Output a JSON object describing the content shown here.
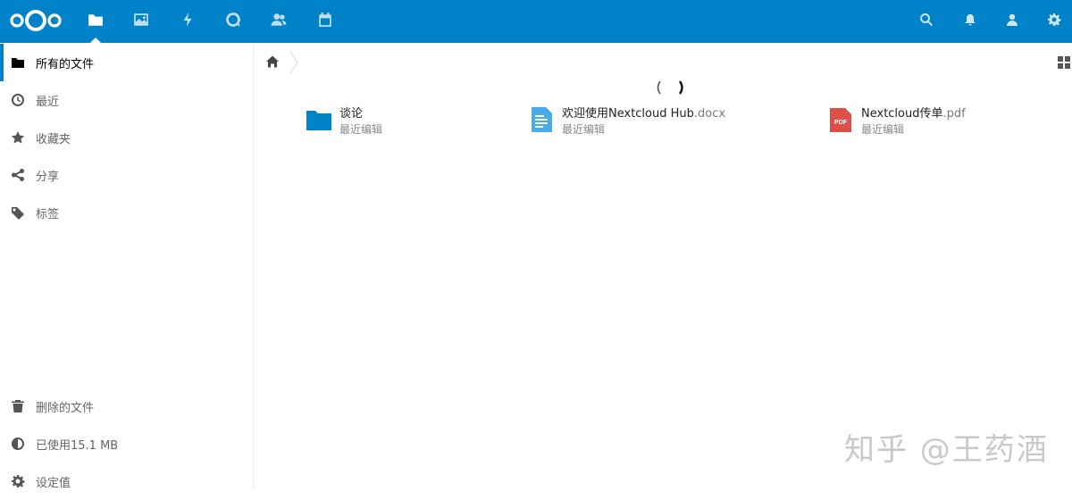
{
  "topbar": {
    "accent": "#0082c9",
    "apps": [
      {
        "name": "files",
        "icon": "folder-icon",
        "active": true
      },
      {
        "name": "photos",
        "icon": "image-icon"
      },
      {
        "name": "activity",
        "icon": "lightning-icon"
      },
      {
        "name": "talk",
        "icon": "talk-icon"
      },
      {
        "name": "contacts",
        "icon": "contacts-icon"
      },
      {
        "name": "calendar",
        "icon": "calendar-icon"
      }
    ],
    "right_icons": [
      "search-icon",
      "bell-icon",
      "user-icon",
      "gear-icon"
    ]
  },
  "sidebar": {
    "items": [
      {
        "label": "所有的文件",
        "icon": "folder-icon",
        "active": true
      },
      {
        "label": "最近",
        "icon": "clock-icon"
      },
      {
        "label": "收藏夹",
        "icon": "star-icon"
      },
      {
        "label": "分享",
        "icon": "share-icon"
      },
      {
        "label": "标签",
        "icon": "tag-icon"
      }
    ],
    "bottom": [
      {
        "label": "删除的文件",
        "icon": "trash-icon"
      },
      {
        "label": "已使用15.1 MB",
        "icon": "quota-icon"
      },
      {
        "label": "设定值",
        "icon": "settings-icon"
      }
    ]
  },
  "files": [
    {
      "name": "谈论",
      "ext": "",
      "type": "folder",
      "subtitle": "最近编辑",
      "color": "#0082c9"
    },
    {
      "name": "欢迎使用Nextcloud Hub",
      "ext": ".docx",
      "type": "document",
      "subtitle": "最近编辑",
      "color": "#49abea"
    },
    {
      "name": "Nextcloud传单",
      "ext": ".pdf",
      "type": "pdf",
      "subtitle": "最近编辑",
      "color": "#dc5047",
      "badge": "PDF"
    }
  ],
  "watermark": "知乎 @王药酒"
}
